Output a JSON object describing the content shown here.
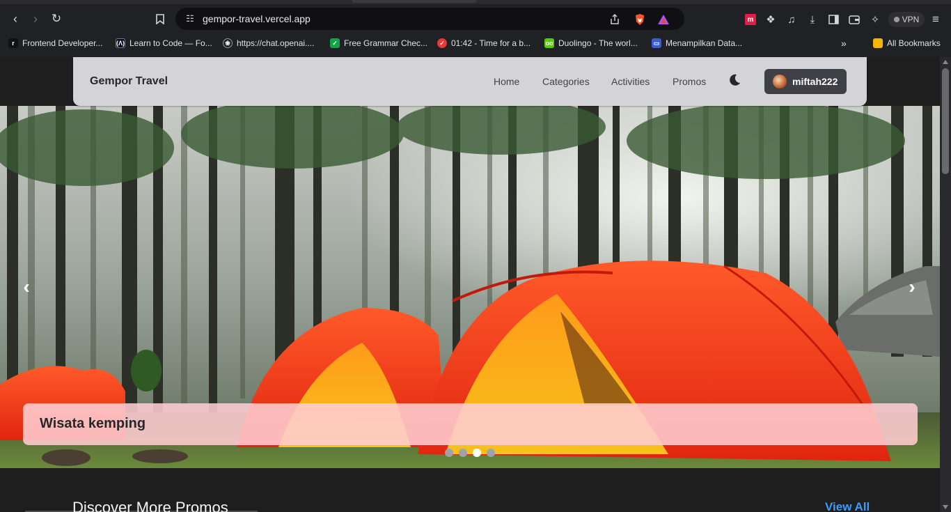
{
  "browser": {
    "url": "gempor-travel.vercel.app",
    "vpn_label": "VPN",
    "bookmarks": [
      {
        "label": "Frontend Developer...",
        "icon": "frontendmentor-icon",
        "color": "#111111"
      },
      {
        "label": "Learn to Code — Fo...",
        "icon": "freecodecamp-icon",
        "color": "#0a0a23"
      },
      {
        "label": "https://chat.openai....",
        "icon": "openai-icon",
        "color": "#202124"
      },
      {
        "label": "Free Grammar Chec...",
        "icon": "grammar-check-icon",
        "color": "#15a34a"
      },
      {
        "label": "01:42 - Time for a b...",
        "icon": "timer-check-icon",
        "color": "#e53935"
      },
      {
        "label": "Duolingo - The worl...",
        "icon": "duolingo-icon",
        "color": "#58cc02"
      },
      {
        "label": "Menampilkan Data...",
        "icon": "laptop-icon",
        "color": "#3b5bdb"
      }
    ],
    "all_bookmarks_label": "All Bookmarks"
  },
  "navbar": {
    "brand": "Gempor Travel",
    "links": [
      "Home",
      "Categories",
      "Activities",
      "Promos"
    ],
    "username": "miftah222"
  },
  "hero": {
    "caption": "Wisata kemping",
    "slide_count": 4,
    "active_slide": 3
  },
  "promos": {
    "title": "Discover More Promos",
    "view_all": "View All"
  },
  "colors": {
    "navbar_bg": "#d4d4d8",
    "page_bg": "#1e1e1f",
    "link_accent": "#3b9bff",
    "caption_bg": "#ffcdd2"
  }
}
